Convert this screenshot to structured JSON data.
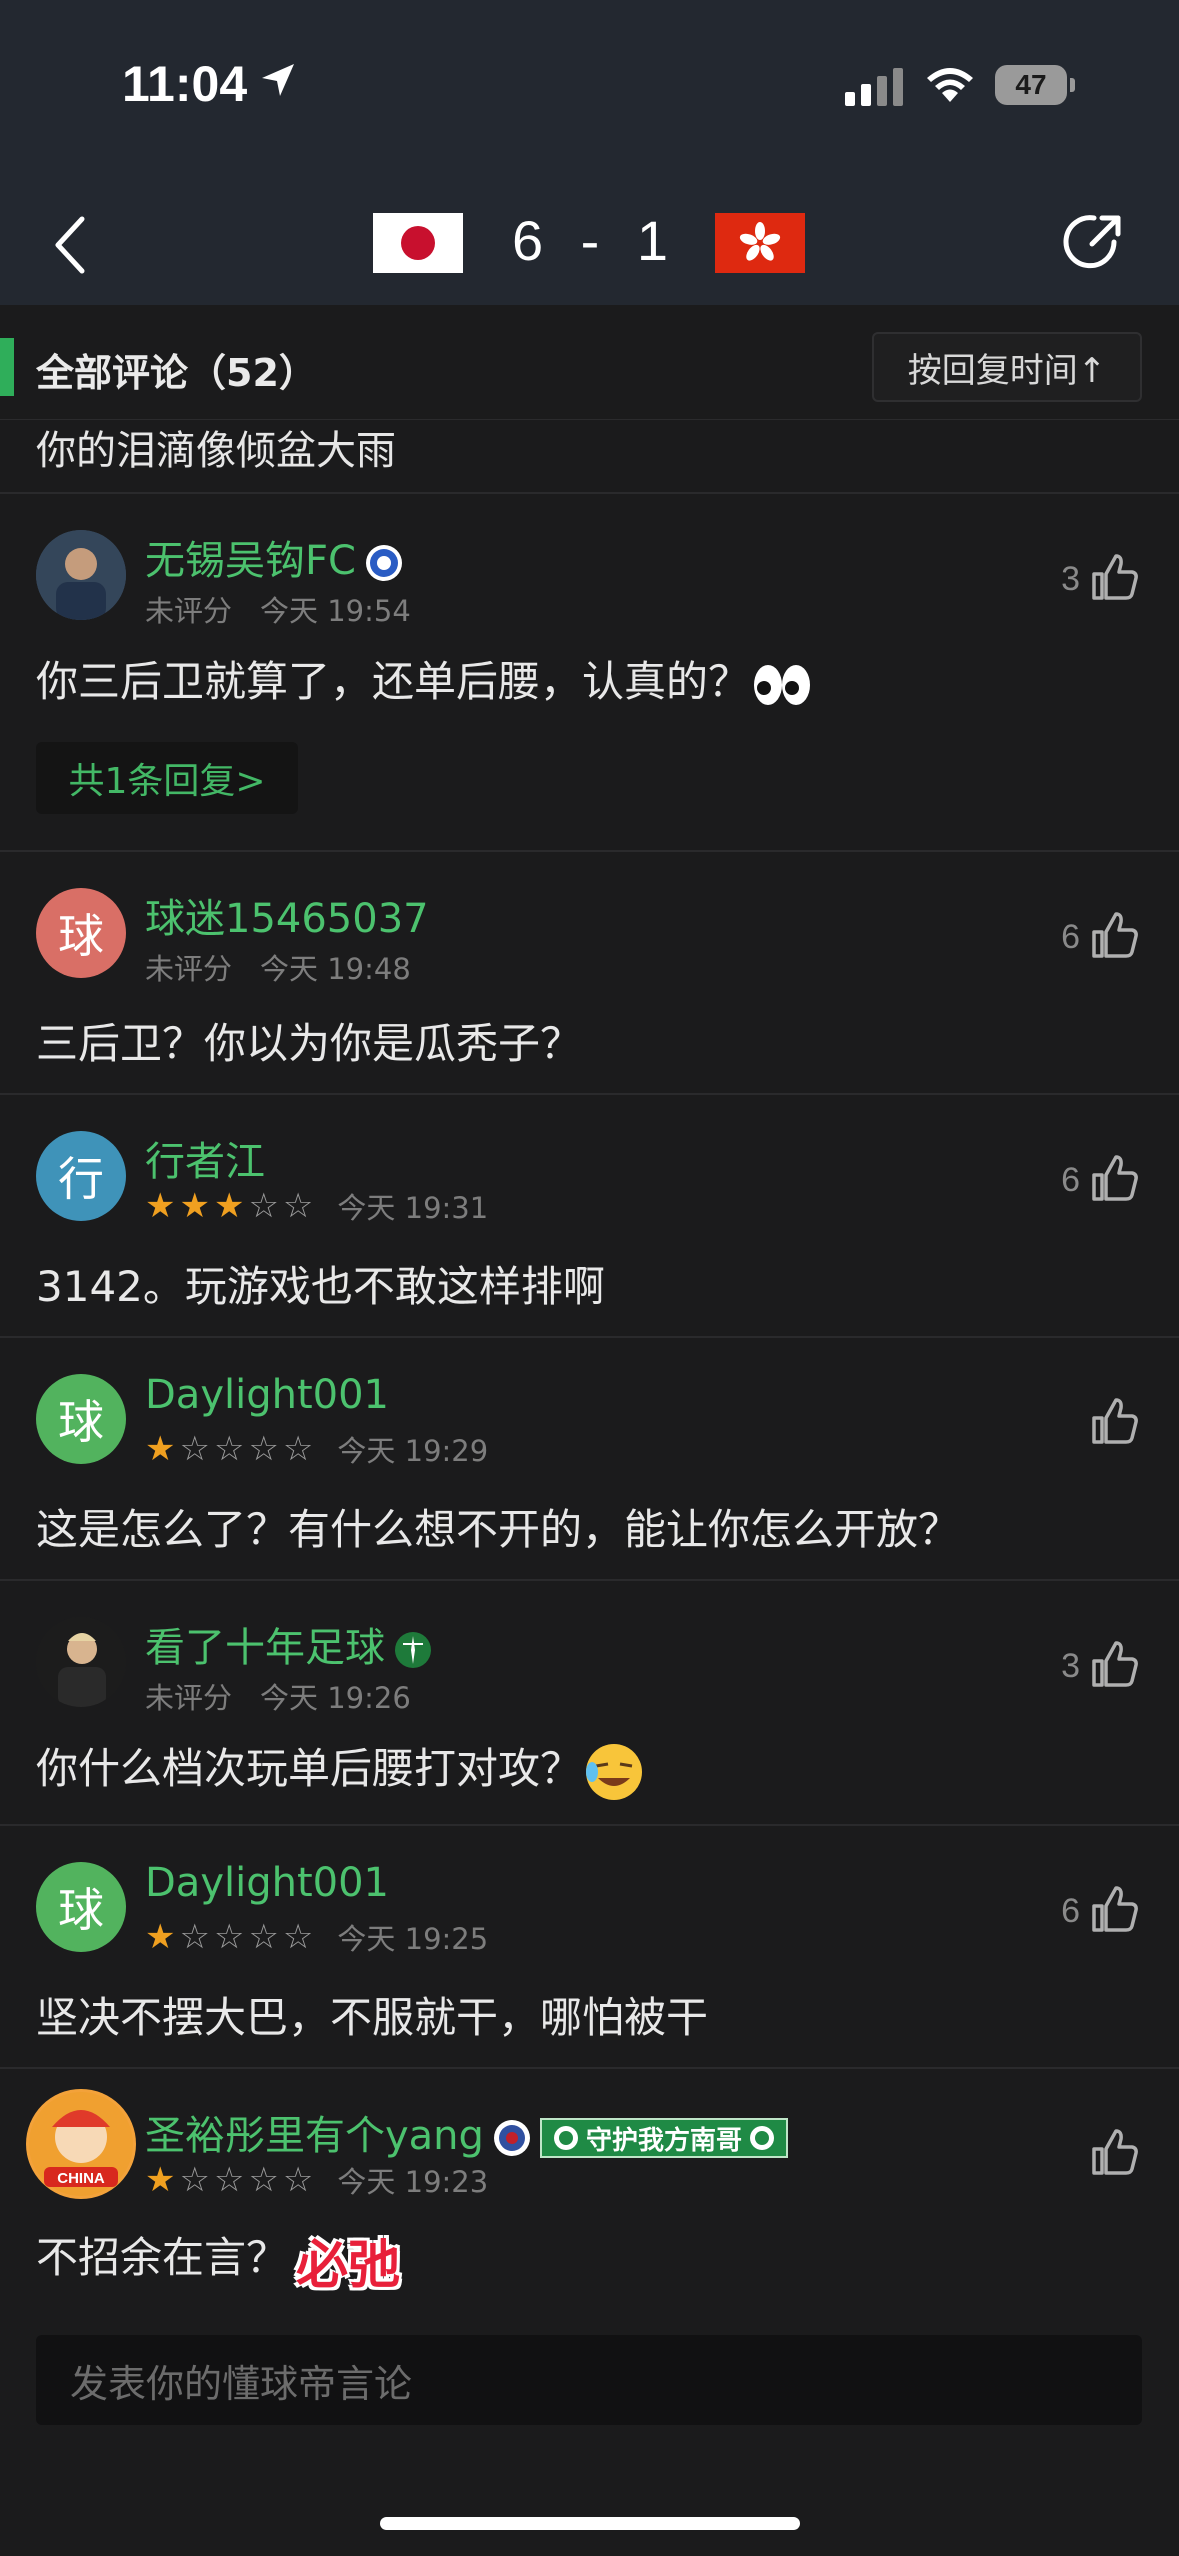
{
  "status": {
    "time": "11:04",
    "battery": "47"
  },
  "match": {
    "home_flag": "japan-flag",
    "away_flag": "hong-kong-flag",
    "score_home": "6",
    "score_sep": "-",
    "score_away": "1"
  },
  "list": {
    "title": "全部评论（52）",
    "sort_label": "按回复时间↑",
    "partial_text": "你的泪滴像倾盆大雨"
  },
  "comments": [
    {
      "user": "无锡吴钩FC",
      "rating": "未评分",
      "time": "今天 19:54",
      "text": "你三后卫就算了，还单后腰，认真的？",
      "likes": "3",
      "reply": "共1条回复>"
    },
    {
      "user": "球迷15465037",
      "avatar": "球",
      "rating": "未评分",
      "time": "今天 19:48",
      "text": "三后卫？你以为你是瓜秃子？",
      "likes": "6"
    },
    {
      "user": "行者江",
      "avatar": "行",
      "stars": 3,
      "time": "今天 19:31",
      "text": "3142。玩游戏也不敢这样排啊",
      "likes": "6"
    },
    {
      "user": "Daylight001",
      "avatar": "球",
      "stars": 1,
      "time": "今天 19:29",
      "text": "这是怎么了？有什么想不开的，能让你怎么开放？",
      "likes": ""
    },
    {
      "user": "看了十年足球",
      "rating": "未评分",
      "time": "今天 19:26",
      "text": "你什么档次玩单后腰打对攻？",
      "likes": "3"
    },
    {
      "user": "Daylight001",
      "avatar": "球",
      "stars": 1,
      "time": "今天 19:25",
      "text": "坚决不摆大巴，不服就干，哪怕被干",
      "likes": "6"
    },
    {
      "user": "圣裕彤里有个yang",
      "badge_text": "守护我方南哥",
      "avatar_text": "CHINA",
      "stars": 1,
      "time": "今天 19:23",
      "text": "不招余在言？",
      "sticker_text": "必弛",
      "likes": ""
    }
  ],
  "input": {
    "placeholder": "发表你的懂球帝言论"
  },
  "colors": {
    "accent_green": "#4cc26e",
    "header_bg": "#232830",
    "page_bg": "#1b1b1c",
    "star": "#f0a020"
  }
}
